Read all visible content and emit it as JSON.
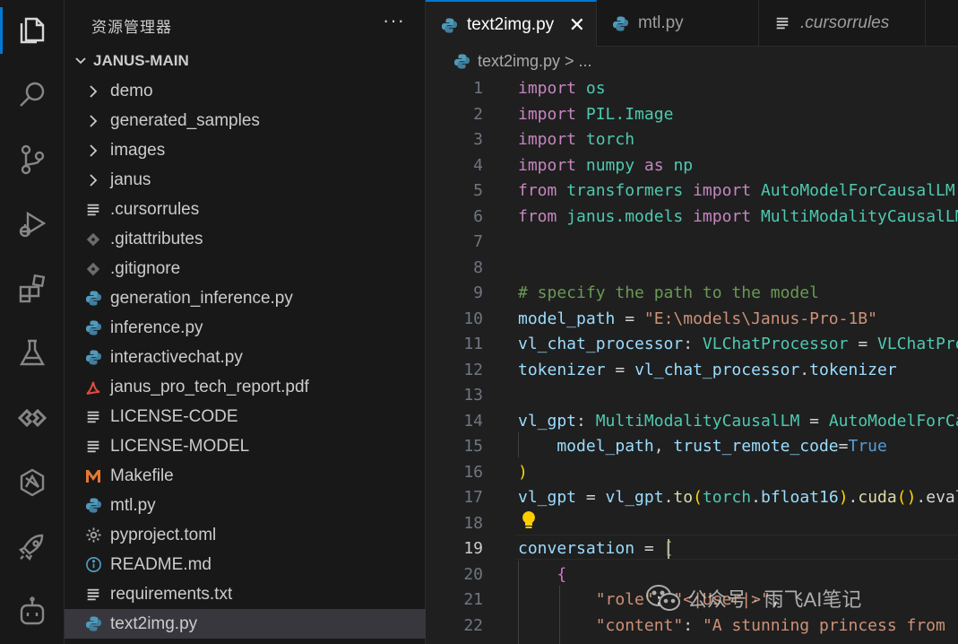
{
  "explorer": {
    "title": "资源管理器",
    "more": "···",
    "root_label": "JANUS-MAIN",
    "items": [
      {
        "label": "demo",
        "icon": "chevron-right-icon"
      },
      {
        "label": "generated_samples",
        "icon": "chevron-right-icon"
      },
      {
        "label": "images",
        "icon": "chevron-right-icon"
      },
      {
        "label": "janus",
        "icon": "chevron-right-icon"
      },
      {
        "label": ".cursorrules",
        "icon": "lines-file-icon"
      },
      {
        "label": ".gitattributes",
        "icon": "git-diamond-icon"
      },
      {
        "label": ".gitignore",
        "icon": "git-diamond-icon"
      },
      {
        "label": "generation_inference.py",
        "icon": "python-icon"
      },
      {
        "label": "inference.py",
        "icon": "python-icon"
      },
      {
        "label": "interactivechat.py",
        "icon": "python-icon"
      },
      {
        "label": "janus_pro_tech_report.pdf",
        "icon": "pdf-icon"
      },
      {
        "label": "LICENSE-CODE",
        "icon": "lines-file-icon"
      },
      {
        "label": "LICENSE-MODEL",
        "icon": "lines-file-icon"
      },
      {
        "label": "Makefile",
        "icon": "makefile-m-icon"
      },
      {
        "label": "mtl.py",
        "icon": "python-icon"
      },
      {
        "label": "pyproject.toml",
        "icon": "gear-icon"
      },
      {
        "label": "README.md",
        "icon": "info-icon"
      },
      {
        "label": "requirements.txt",
        "icon": "lines-file-icon"
      },
      {
        "label": "text2img.py",
        "icon": "python-icon"
      }
    ]
  },
  "tabs": [
    {
      "label": "text2img.py",
      "close": "✕"
    },
    {
      "label": "mtl.py"
    },
    {
      "label": ".cursorrules"
    }
  ],
  "breadcrumb": {
    "label": "text2img.py > ..."
  },
  "editor": {
    "line_numbers": [
      "1",
      "2",
      "3",
      "4",
      "5",
      "6",
      "7",
      "8",
      "9",
      "10",
      "11",
      "12",
      "13",
      "14",
      "15",
      "16",
      "17",
      "18",
      "19",
      "20",
      "21",
      "22"
    ],
    "current_line": "19",
    "lines": [
      [
        {
          "t": "import",
          "c": "kw"
        },
        {
          "t": " ",
          "c": "op"
        },
        {
          "t": "os",
          "c": "mod"
        }
      ],
      [
        {
          "t": "import",
          "c": "kw"
        },
        {
          "t": " ",
          "c": "op"
        },
        {
          "t": "PIL.Image",
          "c": "mod"
        }
      ],
      [
        {
          "t": "import",
          "c": "kw"
        },
        {
          "t": " ",
          "c": "op"
        },
        {
          "t": "torch",
          "c": "mod"
        }
      ],
      [
        {
          "t": "import",
          "c": "kw"
        },
        {
          "t": " ",
          "c": "op"
        },
        {
          "t": "numpy",
          "c": "mod"
        },
        {
          "t": " ",
          "c": "op"
        },
        {
          "t": "as",
          "c": "kw"
        },
        {
          "t": " ",
          "c": "op"
        },
        {
          "t": "np",
          "c": "mod"
        }
      ],
      [
        {
          "t": "from",
          "c": "kw"
        },
        {
          "t": " ",
          "c": "op"
        },
        {
          "t": "transformers",
          "c": "mod"
        },
        {
          "t": " ",
          "c": "op"
        },
        {
          "t": "import",
          "c": "kw"
        },
        {
          "t": " ",
          "c": "op"
        },
        {
          "t": "AutoModelForCausalLM",
          "c": "cls"
        }
      ],
      [
        {
          "t": "from",
          "c": "kw"
        },
        {
          "t": " ",
          "c": "op"
        },
        {
          "t": "janus.models",
          "c": "mod"
        },
        {
          "t": " ",
          "c": "op"
        },
        {
          "t": "import",
          "c": "kw"
        },
        {
          "t": " ",
          "c": "op"
        },
        {
          "t": "MultiModalityCausalLM",
          "c": "cls"
        }
      ],
      [],
      [],
      [
        {
          "t": "# specify the path to the model",
          "c": "cmt"
        }
      ],
      [
        {
          "t": "model_path",
          "c": "var"
        },
        {
          "t": " = ",
          "c": "op"
        },
        {
          "t": "\"E:\\models\\Janus-Pro-1B\"",
          "c": "str"
        }
      ],
      [
        {
          "t": "vl_chat_processor",
          "c": "var"
        },
        {
          "t": ": ",
          "c": "op"
        },
        {
          "t": "VLChatProcessor",
          "c": "cls"
        },
        {
          "t": " = ",
          "c": "op"
        },
        {
          "t": "VLChatProcessor",
          "c": "cls"
        }
      ],
      [
        {
          "t": "tokenizer",
          "c": "var"
        },
        {
          "t": " = ",
          "c": "op"
        },
        {
          "t": "vl_chat_processor",
          "c": "var"
        },
        {
          "t": ".",
          "c": "op"
        },
        {
          "t": "tokenizer",
          "c": "var"
        }
      ],
      [],
      [
        {
          "t": "vl_gpt",
          "c": "var"
        },
        {
          "t": ": ",
          "c": "op"
        },
        {
          "t": "MultiModalityCausalLM",
          "c": "cls"
        },
        {
          "t": " = ",
          "c": "op"
        },
        {
          "t": "AutoModelForCausalLM",
          "c": "cls"
        }
      ],
      [
        {
          "t": "    model_path",
          "c": "var"
        },
        {
          "t": ", ",
          "c": "op"
        },
        {
          "t": "trust_remote_code",
          "c": "var"
        },
        {
          "t": "=",
          "c": "op"
        },
        {
          "t": "True",
          "c": "cnst"
        }
      ],
      [
        {
          "t": ")",
          "c": "b1"
        }
      ],
      [
        {
          "t": "vl_gpt",
          "c": "var"
        },
        {
          "t": " = ",
          "c": "op"
        },
        {
          "t": "vl_gpt",
          "c": "var"
        },
        {
          "t": ".",
          "c": "op"
        },
        {
          "t": "to",
          "c": "fn"
        },
        {
          "t": "(",
          "c": "b1"
        },
        {
          "t": "torch",
          "c": "mod"
        },
        {
          "t": ".",
          "c": "op"
        },
        {
          "t": "bfloat16",
          "c": "var"
        },
        {
          "t": ")",
          "c": "b1"
        },
        {
          "t": ".",
          "c": "op"
        },
        {
          "t": "cuda",
          "c": "fn"
        },
        {
          "t": "()",
          "c": "b1"
        },
        {
          "t": ".eval()",
          "c": "op"
        }
      ],
      [],
      [
        {
          "t": "conversation",
          "c": "var"
        },
        {
          "t": " = ",
          "c": "op"
        },
        {
          "t": "[",
          "c": "b1"
        }
      ],
      [
        {
          "t": "    ",
          "c": "op"
        },
        {
          "t": "{",
          "c": "b2"
        }
      ],
      [
        {
          "t": "        ",
          "c": "op"
        },
        {
          "t": "\"role\"",
          "c": "str"
        },
        {
          "t": ": ",
          "c": "op"
        },
        {
          "t": "\"<|User|>\"",
          "c": "str"
        },
        {
          "t": ",",
          "c": "op"
        }
      ],
      [
        {
          "t": "        ",
          "c": "op"
        },
        {
          "t": "\"content\"",
          "c": "str"
        },
        {
          "t": ": ",
          "c": "op"
        },
        {
          "t": "\"A stunning princess from",
          "c": "str"
        }
      ]
    ]
  },
  "watermark": {
    "text": "公众号 · 雨飞AI笔记"
  }
}
